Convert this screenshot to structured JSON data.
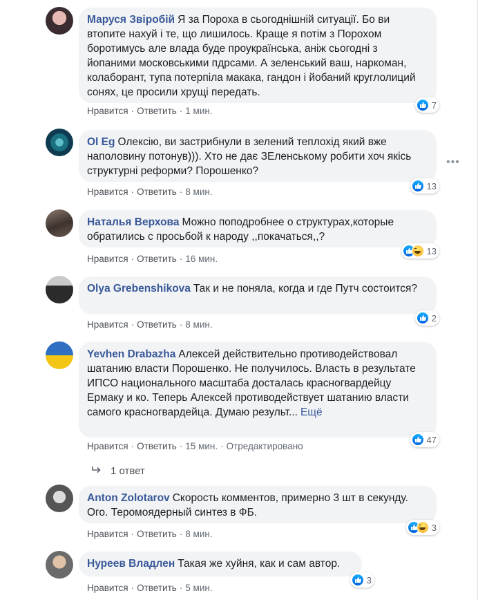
{
  "ui": {
    "like_label": "Нравится",
    "reply_label": "Ответить",
    "dot": "·",
    "more_label": "Ещё"
  },
  "comments": [
    {
      "author": "Маруся Звіробій",
      "text": "Я за Пороха в сьогоднішній ситуації. Бо ви втопите нахуй і те, що лишилось. Краще я потім з Порохом боротимусь але влада буде проукраїнська, аніж сьогодні з йопаними московськими пдрсами. А зеленський ваш, наркоман, колаборант, тупа потерпіла макака, гандон і йобаний круглолиций сонях, це просили хрущі передать.",
      "reactions": "7",
      "time": "1 мин."
    },
    {
      "author": "Ol Eg",
      "text": "Олексію, ви застрибнули в зелений теплохід який вже наполовину потонув))). Хто не дає ЗЕленському робити хоч якісь структурні реформи? Порошенко?",
      "reactions": "13",
      "time": "8 мин."
    },
    {
      "author": "Наталья Верхова",
      "text": "Можно поподробнее о структурах,которые обратились с просьбой к народу ,,покачаться,,?",
      "reactions": "13",
      "time": "16 мин."
    },
    {
      "author": "Olya Grebenshikova",
      "text": "Так и не поняла, когда и где Путч состоится?",
      "reactions": "2",
      "time": "8 мин."
    },
    {
      "author": "Yevhen Drabazha",
      "text": "Алексей действительно противодействовал шатанию власти Порошенко. Не получилось. Власть в результате ИПСО национального масштаба досталась красногвардейцу Ермаку и ко. Теперь Алексей противодействует шатанию власти самого красногвардейца. Думаю результ...",
      "reactions": "47",
      "time": "15 мин.",
      "edited": "Отредактировано"
    },
    {
      "author": "Anton Zolotarov",
      "text": "Скорость комментов, примерно 3 шт в секунду. Ого. Теромоядерный синтез в ФБ.",
      "reactions": "3",
      "time": "8 мин."
    },
    {
      "author": "Нуреев Владлен",
      "text": "Такая же хуйня, как и сам автор.",
      "reactions": "3",
      "time": "5 мин."
    }
  ],
  "replies_link": "1 ответ",
  "reaction_icons": [
    "like-icon",
    "haha-icon"
  ]
}
